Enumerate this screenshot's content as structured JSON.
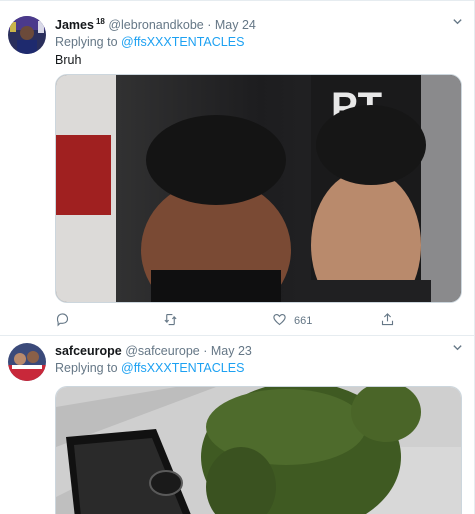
{
  "tweets": [
    {
      "display_name": "James",
      "superscript": "18",
      "handle": "@lebronandkobe",
      "separator": "·",
      "date": "May 24",
      "replying_label": "Replying to",
      "replying_to": "@ffsXXXTENTACLES",
      "text": "Bruh",
      "like_count": "661"
    },
    {
      "display_name": "safceurope",
      "handle": "@safceurope",
      "separator": "·",
      "date": "May 23",
      "replying_label": "Replying to",
      "replying_to": "@ffsXXXTENTACLES"
    }
  ],
  "icons": {
    "caret": "chevron-down-icon",
    "reply": "reply-icon",
    "retweet": "retweet-icon",
    "like": "heart-icon",
    "share": "share-icon"
  },
  "colors": {
    "link": "#1da1f2",
    "secondary_text": "#657786",
    "border": "#e6ecf0"
  }
}
